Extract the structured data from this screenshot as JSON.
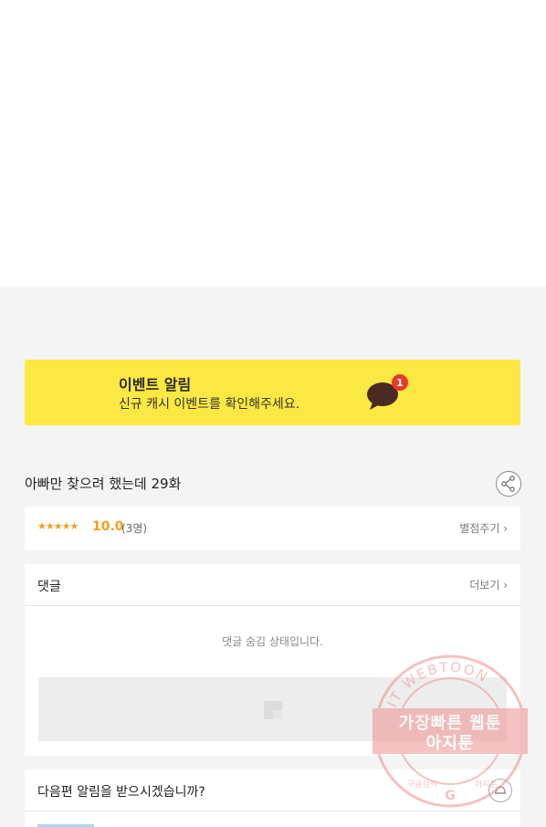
{
  "event_banner": {
    "title": "이벤트 알림",
    "description": "신규 캐시 이벤트를 확인해주세요.",
    "badge_count": "1",
    "icon": "chat-bubble-icon"
  },
  "episode": {
    "title": "아빠만 찾으려 했는데 29화",
    "share_icon": "share-icon"
  },
  "rating": {
    "stars": "★★★★★",
    "score": "10.0",
    "count": "(3명)",
    "rate_link": "별점주기 ›"
  },
  "comments": {
    "title": "댓글",
    "more_link": "더보기 ›",
    "hidden_message": "댓글 숨김 상태입니다.",
    "placeholder_icon": "image-placeholder-icon"
  },
  "notify": {
    "question": "다음편 알림을 받으시겠습니까?",
    "toggle_icon": "bell-icon"
  },
  "watermark": {
    "ring_text": "AGIT WEBTOON",
    "line1": "가장빠른 웹툰",
    "line2": "아지툰",
    "bottom_left": "구글검색",
    "bottom_right": "아지툰"
  },
  "colors": {
    "banner_bg": "#fce843",
    "accent_orange": "#f59e1a",
    "badge_red": "#e8392c",
    "watermark_red": "#ee8f8f",
    "page_bg": "#f4f4f4"
  }
}
